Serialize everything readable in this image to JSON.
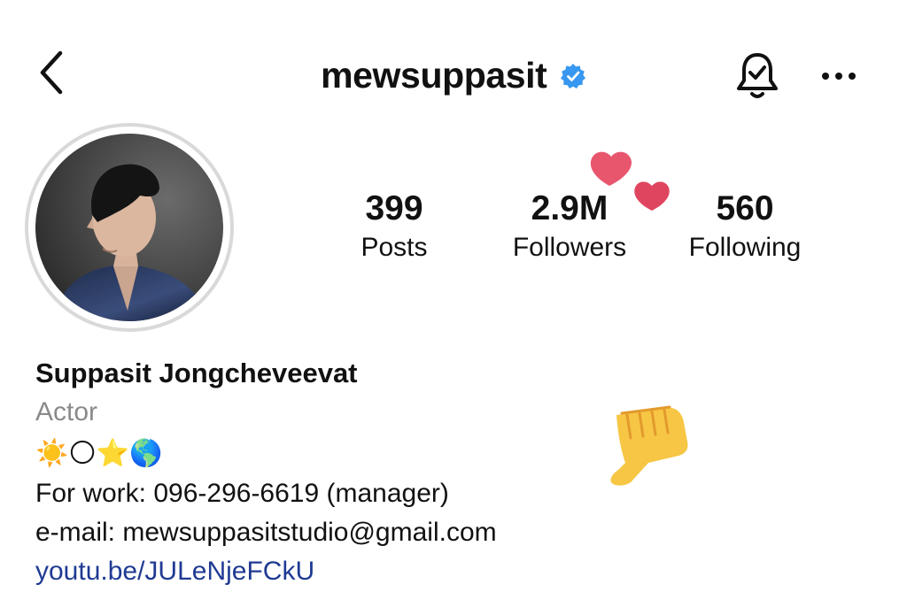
{
  "header": {
    "username": "mewsuppasit",
    "verified": true,
    "icons": [
      "back-arrow-icon",
      "verified-badge-icon",
      "notification-bell-icon",
      "more-options-icon"
    ]
  },
  "stats": {
    "posts": {
      "count": "399",
      "label": "Posts"
    },
    "followers": {
      "count": "2.9M",
      "label": "Followers"
    },
    "following": {
      "count": "560",
      "label": "Following"
    }
  },
  "bio": {
    "name": "Suppasit Jongcheveevat",
    "category": "Actor",
    "emojis": "☀️🌕⭐🌎",
    "work": "For work: 096-296-6619 (manager)",
    "email": "e-mail: mewsuppasitstudio@gmail.com",
    "link": "youtu.be/JULeNjeFCkU"
  },
  "colors": {
    "verified_blue": "#3897f0",
    "link_blue": "#1f3a93",
    "secondary_gray": "#8a8a8a",
    "heart_pink": "#e8566e",
    "sticker_yellow": "#f6c644"
  }
}
